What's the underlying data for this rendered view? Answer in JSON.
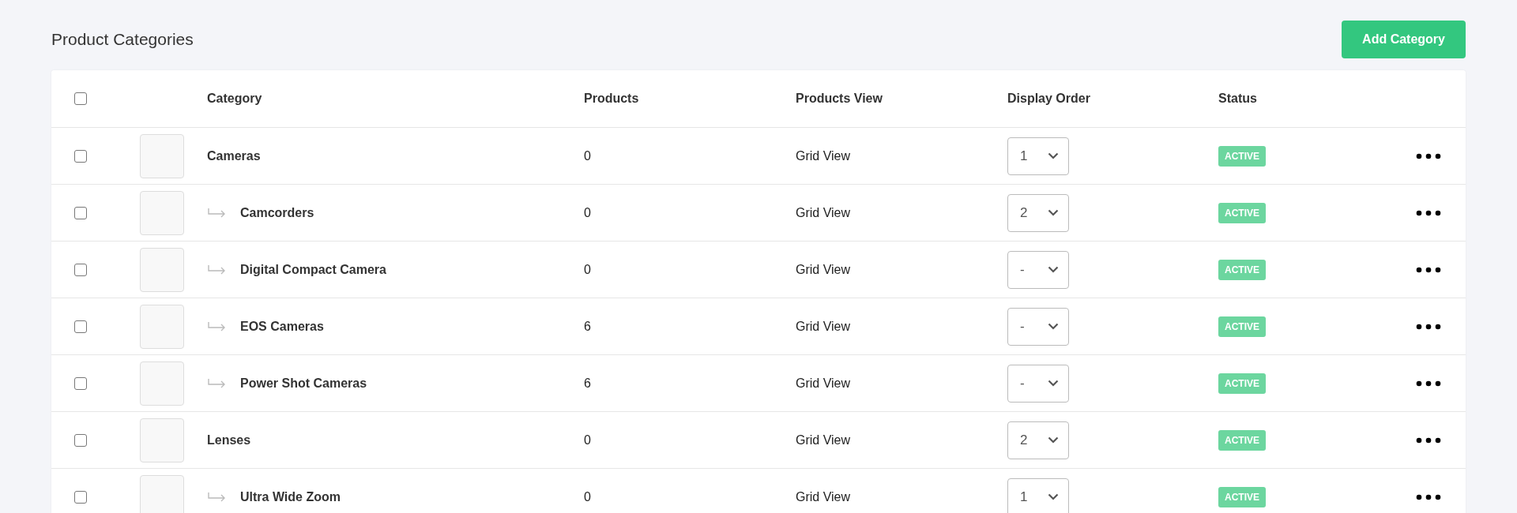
{
  "page": {
    "title": "Product Categories",
    "add_button": "Add Category"
  },
  "table": {
    "select_all": {
      "checked": false
    },
    "columns": [
      "Category",
      "Products",
      "Products View",
      "Display Order",
      "Status"
    ],
    "rows": [
      {
        "name": "Cameras",
        "checked": false,
        "products": "0",
        "view": "Grid View",
        "order": "1",
        "status": "ACTIVE",
        "children": [
          {
            "name": "Camcorders",
            "checked": false,
            "products": "0",
            "view": "Grid View",
            "order": "2",
            "status": "ACTIVE"
          },
          {
            "name": "Digital Compact Camera",
            "checked": false,
            "products": "0",
            "view": "Grid View",
            "order": "-",
            "status": "ACTIVE"
          },
          {
            "name": "EOS Cameras",
            "checked": false,
            "products": "6",
            "view": "Grid View",
            "order": "-",
            "status": "ACTIVE"
          },
          {
            "name": "Power Shot Cameras",
            "checked": false,
            "products": "6",
            "view": "Grid View",
            "order": "-",
            "status": "ACTIVE"
          }
        ]
      },
      {
        "name": "Lenses",
        "checked": false,
        "products": "0",
        "view": "Grid View",
        "order": "2",
        "status": "ACTIVE",
        "children": [
          {
            "name": "Ultra Wide Zoom",
            "checked": false,
            "products": "0",
            "view": "Grid View",
            "order": "1",
            "status": "ACTIVE"
          }
        ]
      }
    ]
  }
}
